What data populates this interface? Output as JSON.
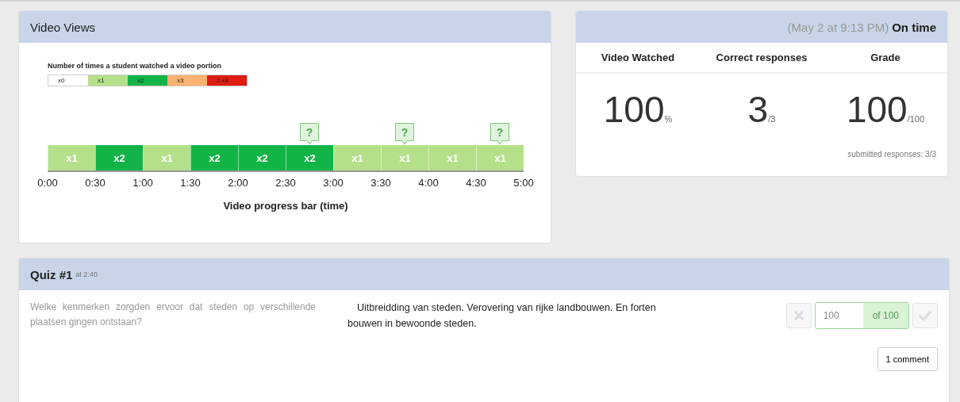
{
  "video_views": {
    "title": "Video Views",
    "legend_title": "Number of times a student watched a video portion",
    "legend": [
      {
        "label": "x0",
        "color": "#ffffff"
      },
      {
        "label": "x1",
        "color": "#b5e08a"
      },
      {
        "label": "x2",
        "color": "#12b347"
      },
      {
        "label": "x3",
        "color": "#f9b26f"
      },
      {
        "label": "≥ x4",
        "color": "#dd1c12"
      }
    ],
    "segments": [
      {
        "label": "x1",
        "color": "#b5e08a",
        "question": false
      },
      {
        "label": "x2",
        "color": "#12b347",
        "question": false
      },
      {
        "label": "x1",
        "color": "#b5e08a",
        "question": false
      },
      {
        "label": "x2",
        "color": "#12b347",
        "question": false
      },
      {
        "label": "x2",
        "color": "#12b347",
        "question": false
      },
      {
        "label": "x2",
        "color": "#12b347",
        "question": true
      },
      {
        "label": "x1",
        "color": "#b5e08a",
        "question": false
      },
      {
        "label": "x1",
        "color": "#b5e08a",
        "question": true
      },
      {
        "label": "x1",
        "color": "#b5e08a",
        "question": false
      },
      {
        "label": "x1",
        "color": "#b5e08a",
        "question": true
      }
    ],
    "question_mark": "?",
    "ticks": [
      "0:00",
      "0:30",
      "1:00",
      "1:30",
      "2:00",
      "2:30",
      "3:00",
      "3:30",
      "4:00",
      "4:30",
      "5:00"
    ],
    "axis_label": "Video progress bar (time)"
  },
  "summary": {
    "submitted_at": "(May 2 at 9:13 PM)",
    "status": "On time",
    "columns": [
      {
        "heading": "Video Watched",
        "value": "100",
        "unit": "%"
      },
      {
        "heading": "Correct responses",
        "value": "3",
        "unit": "/3"
      },
      {
        "heading": "Grade",
        "value": "100",
        "unit": "/100"
      }
    ],
    "submitted_responses": "submitted responses: 3/3"
  },
  "quiz": {
    "title": "Quiz #1",
    "time": "at 2:40",
    "question": "Welke kenmerken zorgden ervoor dat steden op verschillende plaatsen gingen ontstaan?",
    "answer": "Uitbreidding van steden. Verovering van rijke landbouwen. En forten bouwen in bewoonde steden.",
    "score": "100",
    "score_of": "of 100",
    "comment_button": "1 comment"
  }
}
